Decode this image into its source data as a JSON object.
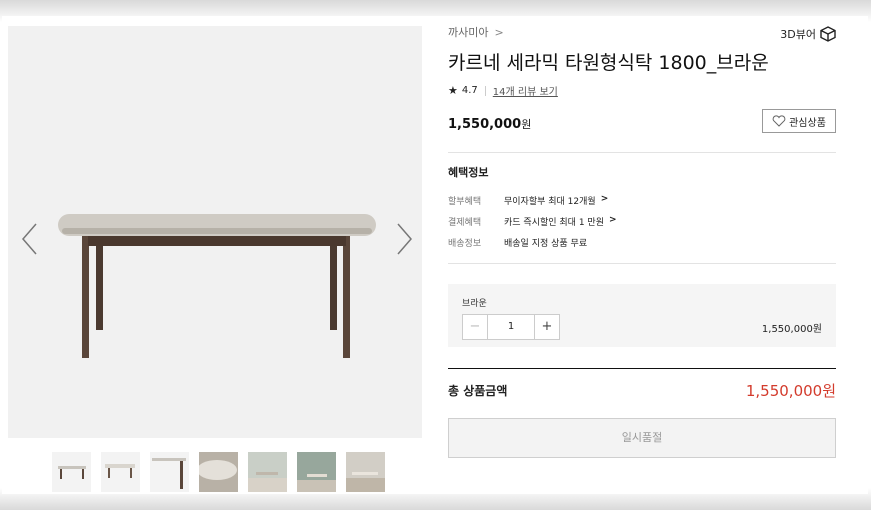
{
  "product": {
    "brand": "까사미아",
    "title": "카르네 세라믹 타원형식탁 1800_브라운",
    "rating": "4.7",
    "reviews_link": "14개 리뷰 보기",
    "price": "1,550,000",
    "price_unit": "원",
    "viewer_3d": "3D뷰어",
    "wishlist": "관심상품"
  },
  "benefits": {
    "title": "혜택정보",
    "rows": [
      {
        "key": "할부혜택",
        "value": "무이자할부 최대 12개월"
      },
      {
        "key": "결제혜택",
        "value": "카드 즉시할인 최대 1 만원"
      },
      {
        "key": "배송정보",
        "value": "배송일 지정 상품 무료"
      }
    ]
  },
  "option": {
    "name": "브라운",
    "quantity": "1",
    "price": "1,550,000원",
    "minus": "−",
    "plus": "+"
  },
  "total": {
    "label": "총 상품금액",
    "price": "1,550,000원"
  },
  "cta": {
    "soldout": "일시품절"
  },
  "icons": {
    "prev": "chevron-left-icon",
    "next": "chevron-right-icon",
    "star": "star-icon",
    "heart": "heart-icon",
    "cube": "cube-icon"
  },
  "colors": {
    "accent_price": "#d33b2c"
  }
}
